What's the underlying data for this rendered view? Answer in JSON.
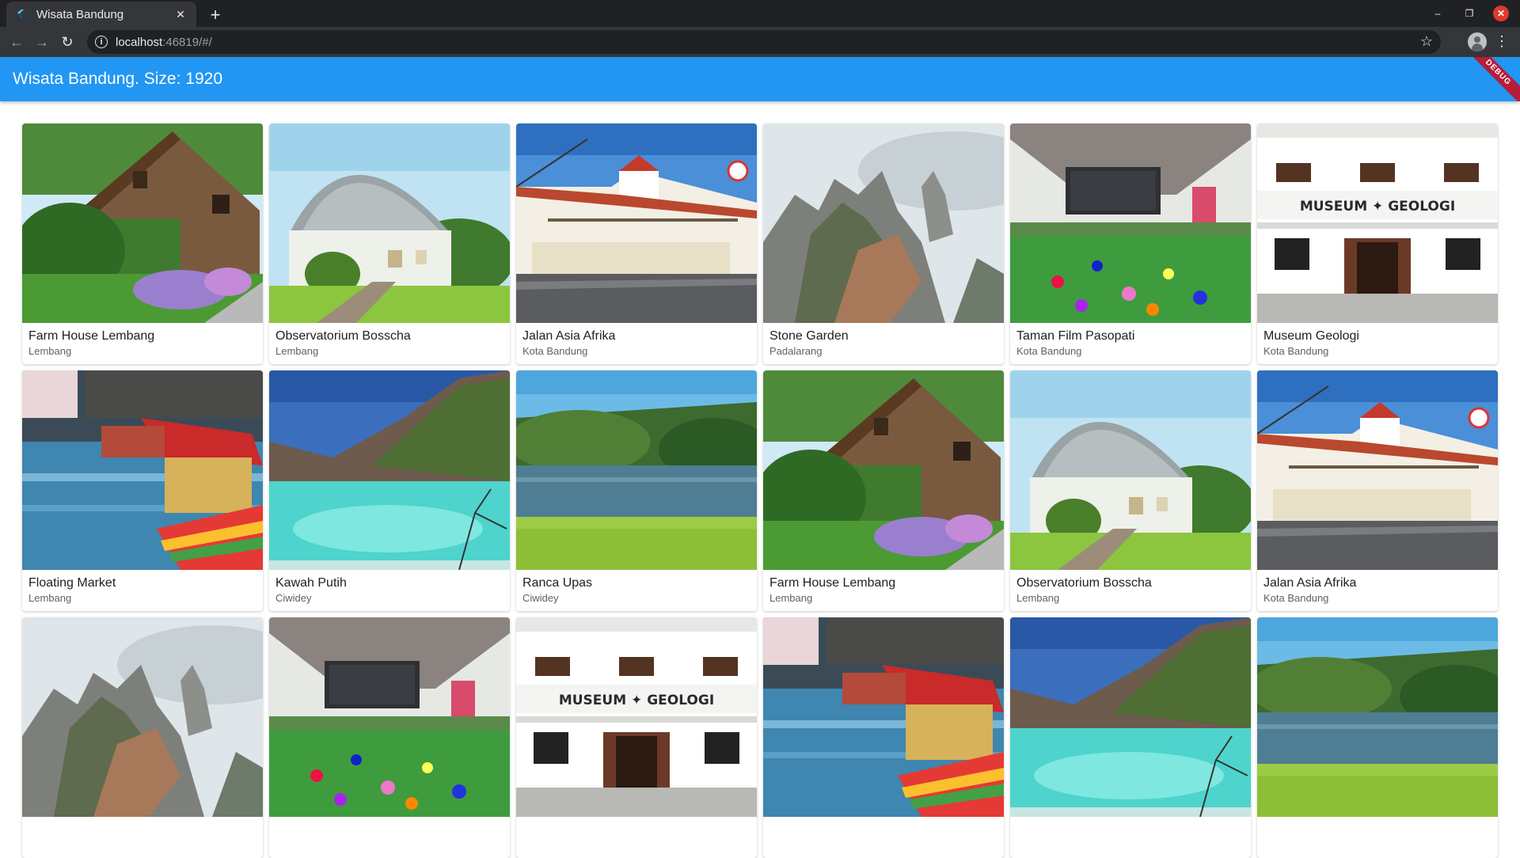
{
  "browser": {
    "tab_title": "Wisata Bandung",
    "url_host": "localhost",
    "url_rest": ":46819/#/"
  },
  "app": {
    "title": "Wisata Bandung. Size: 1920",
    "debug_label": "DEBUG",
    "primary_color": "#2196f3"
  },
  "places": [
    {
      "name": "Farm House Lembang",
      "location": "Lembang",
      "scene": "farmhouse"
    },
    {
      "name": "Observatorium Bosscha",
      "location": "Lembang",
      "scene": "observatory"
    },
    {
      "name": "Jalan Asia Afrika",
      "location": "Kota Bandung",
      "scene": "street"
    },
    {
      "name": "Stone Garden",
      "location": "Padalarang",
      "scene": "rocks"
    },
    {
      "name": "Taman Film Pasopati",
      "location": "Kota Bandung",
      "scene": "park"
    },
    {
      "name": "Museum Geologi",
      "location": "Kota Bandung",
      "scene": "museum"
    },
    {
      "name": "Floating Market",
      "location": "Lembang",
      "scene": "market"
    },
    {
      "name": "Kawah Putih",
      "location": "Ciwidey",
      "scene": "crater"
    },
    {
      "name": "Ranca Upas",
      "location": "Ciwidey",
      "scene": "lake"
    },
    {
      "name": "Farm House Lembang",
      "location": "Lembang",
      "scene": "farmhouse"
    },
    {
      "name": "Observatorium Bosscha",
      "location": "Lembang",
      "scene": "observatory"
    },
    {
      "name": "Jalan Asia Afrika",
      "location": "Kota Bandung",
      "scene": "street"
    },
    {
      "name": "",
      "location": "",
      "scene": "rocks"
    },
    {
      "name": "",
      "location": "",
      "scene": "park"
    },
    {
      "name": "",
      "location": "",
      "scene": "museum"
    },
    {
      "name": "",
      "location": "",
      "scene": "market"
    },
    {
      "name": "",
      "location": "",
      "scene": "crater"
    },
    {
      "name": "",
      "location": "",
      "scene": "lake"
    }
  ]
}
